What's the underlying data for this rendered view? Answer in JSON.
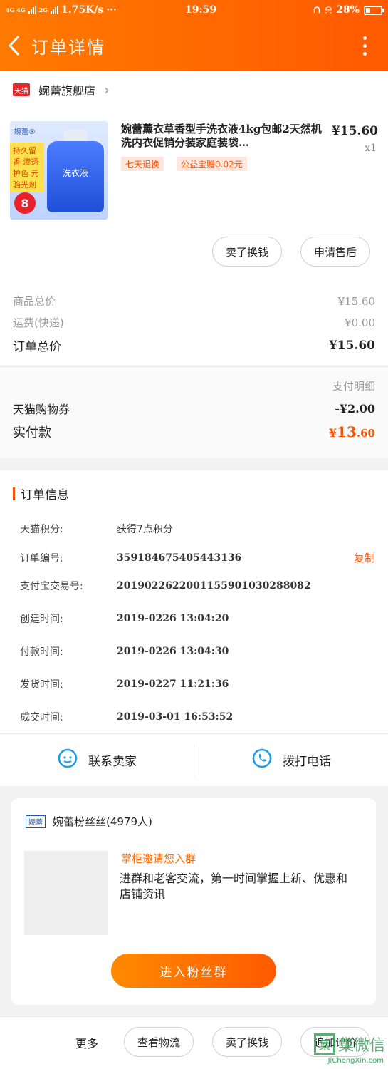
{
  "status_bar": {
    "network_left": "4G 4G",
    "network_2g": "2G",
    "speed": "1.75K/s",
    "dots": "···",
    "time": "19:59",
    "battery": "28%"
  },
  "nav": {
    "title": "订单详情"
  },
  "shop": {
    "badge": "天猫",
    "name": "婉蕾旗舰店"
  },
  "product": {
    "thumb_brand": "婉蕾®",
    "thumb_features": "持久留香 渗透护色 元驺光剂",
    "thumb_label": "洗衣液",
    "thumb_weight": "8",
    "title": "婉蕾薰衣草香型手洗衣液4kg包邮2天然机洗内衣促销分装家庭装袋…",
    "price": "¥15.60",
    "qty": "x1",
    "tags": [
      "七天退换",
      "公益宝赠0.02元"
    ],
    "buttons": [
      "卖了换钱",
      "申请售后"
    ]
  },
  "summary": {
    "goods_total_label": "商品总价",
    "goods_total": "¥15.60",
    "shipping_label": "运费(快递)",
    "shipping": "¥0.00",
    "order_total_label": "订单总价",
    "order_total": "¥15.60"
  },
  "payment": {
    "detail_link": "支付明细",
    "coupon_label": "天猫购物券",
    "coupon_value": "-¥2.00",
    "paid_label": "实付款",
    "paid_symbol": "¥",
    "paid_int": "13",
    "paid_dec": ".60"
  },
  "order_info": {
    "heading": "订单信息",
    "copy": "复制",
    "rows": [
      {
        "k": "天猫积分:",
        "v": "获得7点积分"
      },
      {
        "k": "订单编号:",
        "v": "359184675405443136"
      },
      {
        "k": "支付宝交易号:",
        "v": "2019022622001155901030288082"
      },
      {
        "k": "创建时间:",
        "v": "2019-0226 13:04:20"
      },
      {
        "k": "付款时间:",
        "v": "2019-0226 13:04:30"
      },
      {
        "k": "发货时间:",
        "v": "2019-0227 11:21:36"
      },
      {
        "k": "成交时间:",
        "v": "2019-03-01 16:53:52"
      }
    ]
  },
  "contact": {
    "seller": "联系卖家",
    "call": "拨打电话"
  },
  "fan_group": {
    "logo": "婉蕾",
    "name": "婉蕾粉丝丝(4979人)",
    "title": "掌柜邀请您入群",
    "desc": "进群和老客交流，第一时间掌握上新、优惠和店铺资讯",
    "join": "进入粉丝群"
  },
  "bottom_bar": {
    "more": "更多",
    "buttons": [
      "查看物流",
      "卖了换钱",
      "追加评价"
    ],
    "watermark": "集微信",
    "watermark_box": "集",
    "watermark_sub": "JiChengXin.com"
  },
  "colors": {
    "accent": "#ff5000",
    "topbar": "#ff6a00",
    "tmall_red": "#e4282c"
  }
}
